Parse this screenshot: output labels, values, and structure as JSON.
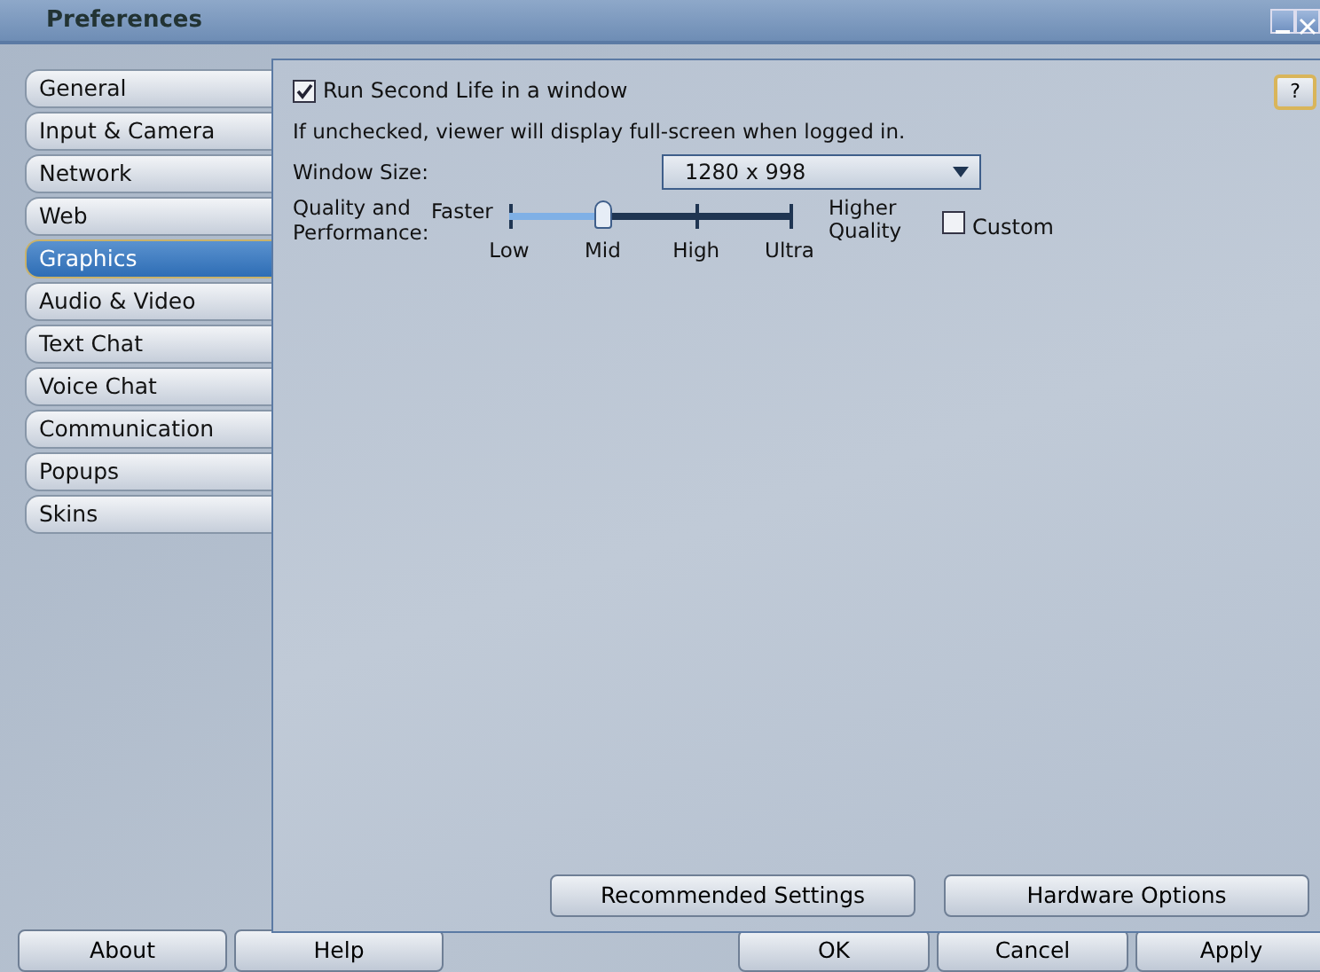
{
  "window": {
    "title": "Preferences"
  },
  "tabs": [
    {
      "label": "General",
      "selected": false
    },
    {
      "label": "Input & Camera",
      "selected": false
    },
    {
      "label": "Network",
      "selected": false
    },
    {
      "label": "Web",
      "selected": false
    },
    {
      "label": "Graphics",
      "selected": true
    },
    {
      "label": "Audio & Video",
      "selected": false
    },
    {
      "label": "Text Chat",
      "selected": false
    },
    {
      "label": "Voice Chat",
      "selected": false
    },
    {
      "label": "Communication",
      "selected": false
    },
    {
      "label": "Popups",
      "selected": false
    },
    {
      "label": "Skins",
      "selected": false
    }
  ],
  "help_button": "?",
  "run_in_window": {
    "label": "Run Second Life in a window",
    "checked": true
  },
  "hint": "If unchecked, viewer will display full-screen when logged in.",
  "window_size": {
    "label": "Window Size:",
    "value": "1280 x 998"
  },
  "quality": {
    "label": "Quality and Performance:",
    "left": "Faster",
    "right": "Higher Quality",
    "level": 0.333,
    "ticks": [
      "Low",
      "Mid",
      "High",
      "Ultra"
    ]
  },
  "custom": {
    "label": "Custom",
    "checked": false
  },
  "panel_buttons": [
    "Recommended Settings",
    "Hardware Options"
  ],
  "left_buttons": [
    "About",
    "Help"
  ],
  "right_buttons": [
    "OK",
    "Cancel",
    "Apply"
  ]
}
